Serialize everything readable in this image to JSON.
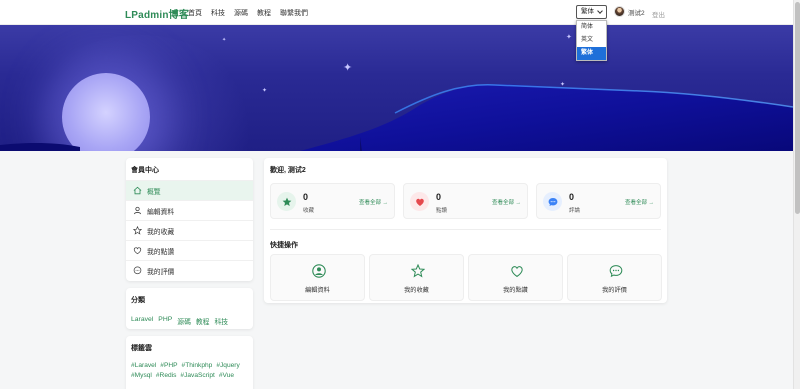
{
  "header": {
    "logo": "LPadmin博客",
    "nav": [
      "首頁",
      "科技",
      "源碼",
      "教程",
      "聯繫我們"
    ],
    "lang_selected": "繁体",
    "lang_options": [
      "简体",
      "英文",
      "繁体"
    ],
    "user_name": "测试2",
    "logout": "登出"
  },
  "sidebar": {
    "member_title": "會員中心",
    "items": [
      {
        "label": "概覽",
        "icon": "home-icon"
      },
      {
        "label": "編輯資料",
        "icon": "user-icon"
      },
      {
        "label": "我的收藏",
        "icon": "star-icon"
      },
      {
        "label": "我的點讚",
        "icon": "heart-icon"
      },
      {
        "label": "我的評價",
        "icon": "comment-icon"
      }
    ],
    "category_title": "分類",
    "categories": [
      "Laravel",
      "PHP",
      "源碼",
      "教程",
      "科技"
    ],
    "tagcloud_title": "標籤雲",
    "tags": [
      "#Laravel",
      "#PHP",
      "#Thinkphp",
      "#Jquery",
      "#Mysql",
      "#Redis",
      "#JavaScript",
      "#Vue"
    ]
  },
  "main": {
    "welcome": "歡迎, 测试2",
    "stats": [
      {
        "value": "0",
        "label": "收藏",
        "link": "查看全部 →",
        "icon": "star-icon",
        "color": "#2e8b57",
        "bg": "#e6f4ec"
      },
      {
        "value": "0",
        "label": "點讚",
        "link": "查看全部 →",
        "icon": "heart-icon",
        "color": "#e5484d",
        "bg": "#fde8e9"
      },
      {
        "value": "0",
        "label": "評論",
        "link": "查看全部 →",
        "icon": "comment-icon",
        "color": "#3b82f6",
        "bg": "#e6effe"
      }
    ],
    "quick_title": "快捷操作",
    "quick": [
      {
        "label": "編輯資料",
        "icon": "user-circle-icon"
      },
      {
        "label": "我的收藏",
        "icon": "star-icon"
      },
      {
        "label": "我的點讚",
        "icon": "heart-icon"
      },
      {
        "label": "我的評價",
        "icon": "comment-icon"
      }
    ]
  },
  "colors": {
    "accent": "#2e8b57",
    "banner": "#2a2a94",
    "lang_active": "#1e6fd9"
  }
}
